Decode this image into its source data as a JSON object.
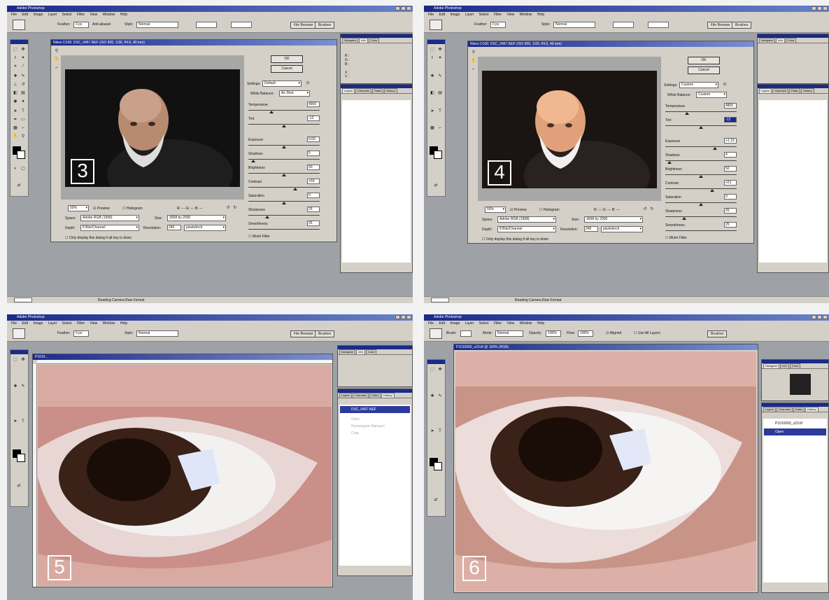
{
  "app": {
    "title": "Adobe Photoshop",
    "menus": [
      "File",
      "Edit",
      "Image",
      "Layer",
      "Select",
      "Filter",
      "View",
      "Window",
      "Help"
    ],
    "menus_alt": [
      "File",
      "Edit",
      "Image",
      "Layer",
      "Select",
      "Filter",
      "View",
      "Window",
      "Help"
    ]
  },
  "options_bar": {
    "feather_label": "Feather:",
    "feather_value": "0 px",
    "antialias_label": "Anti-aliased",
    "style_label": "Style:",
    "style_value": "Normal",
    "width_label": "Width:",
    "height_label": "Height:",
    "file_browser": "File Browser",
    "brushes": "Brushes"
  },
  "options_bar_brush": {
    "brush_label": "Brush:",
    "mode_label": "Mode:",
    "mode_value": "Normal",
    "opacity_label": "Opacity:",
    "opacity_value": "100%",
    "flow_label": "Flow:",
    "flow_value": "100%",
    "aligned_label": "Aligned",
    "use_all_layers_label": "Use All Layers",
    "brushes": "Brushes"
  },
  "camera_raw_3": {
    "title": "Nikon D100: DSC_0467.NEF (ISO 800, 1/30, f/4.5, 40 mm)",
    "step": "3",
    "ok": "OK",
    "cancel": "Cancel",
    "settings_label": "Settings:",
    "settings_value": "Default",
    "wb_label": "White Balance:",
    "wb_value": "As Shot",
    "temperature_label": "Temperature",
    "temperature_value": "4900",
    "tint_label": "Tint",
    "tint_value": "-12",
    "exposure_label": "Exposure",
    "exposure_value": "0.00",
    "shadows_label": "Shadows",
    "shadows_value": "5",
    "brightness_label": "Brightness",
    "brightness_value": "50",
    "contrast_label": "Contrast",
    "contrast_value": "+50",
    "saturation_label": "Saturation",
    "saturation_value": "0",
    "sharpness_label": "Sharpness",
    "sharpness_value": "25",
    "smoothness_label": "Smoothness",
    "smoothness_value": "25",
    "moire_label": "Moiré Filter",
    "zoom_value": "50%",
    "preview_label": "Preview",
    "histogram_label": "Histogram",
    "rgb_readout": "R: --- G: --- B: ---",
    "space_label": "Space:",
    "space_value": "Adobe RGB (1998)",
    "size_label": "Size:",
    "size_value": "3008 by 2000",
    "depth_label": "Depth:",
    "depth_value": "8 Bits/Channel",
    "resolution_label": "Resolution:",
    "resolution_value": "240",
    "resolution_unit": "pixels/inch",
    "only_display": "Only display this dialog if alt key is down"
  },
  "camera_raw_4": {
    "step": "4",
    "settings_value": "Custom",
    "wb_value": "Custom",
    "temperature_value": "4800",
    "tint_value": "-12",
    "exposure_value": "+1.15",
    "shadows_value": "4",
    "brightness_value": "50",
    "contrast_value": "+51",
    "saturation_value": "0",
    "sharpness_value": "25",
    "smoothness_value": "25"
  },
  "status": {
    "zoom": "100%",
    "message": "Reading Camera Raw Format"
  },
  "panel5": {
    "step": "5",
    "doc_title": "P1010...",
    "layers_tabs": [
      "Layers",
      "Channels",
      "Paths",
      "History"
    ],
    "history_items": [
      "DSC_0467.NEF",
      "Open",
      "Rectangular Marquee",
      "Crop"
    ]
  },
  "panel6": {
    "step": "6",
    "doc_title": "P1010000_s23.tif @ 100% (RGB)",
    "history_snapshot": "P1010000_s23.tif",
    "history_item": "Open"
  },
  "palettes": {
    "nav_tabs": [
      "Navigator",
      "Info",
      "Color"
    ],
    "layer_tabs": [
      "Layers",
      "Channels",
      "Paths",
      "History"
    ],
    "info_r": "R :",
    "info_g": "G :",
    "info_b": "B :",
    "info_x": "X :",
    "info_y": "Y :"
  },
  "colors": {
    "titlebar": "#1a2a8a",
    "workspace": "#9ea1a6",
    "chrome": "#d4d0c8"
  }
}
